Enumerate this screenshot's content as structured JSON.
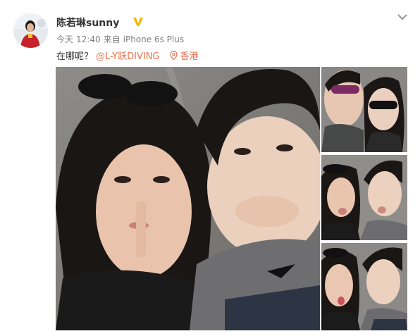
{
  "post": {
    "author": {
      "name": "陈若琳sunny",
      "verified_badge_icon": "verified-v-icon",
      "avatar_icon": "user-avatar"
    },
    "meta": {
      "day": "今天",
      "time": "12:40",
      "source_prefix": "来自",
      "device": "iPhone 6s Plus"
    },
    "text": "在哪呢？",
    "mention": "@L-Y跃DIVING",
    "location": {
      "icon": "location-pin-icon",
      "label": "香港"
    },
    "menu_icon": "chevron-down-icon",
    "photos": [
      "selfie-main",
      "selfie-sunglasses",
      "selfie-kiss",
      "selfie-wink"
    ]
  },
  "colors": {
    "link": "#eb7350",
    "badge": "#f5b700",
    "text": "#333333",
    "meta": "#808080"
  }
}
